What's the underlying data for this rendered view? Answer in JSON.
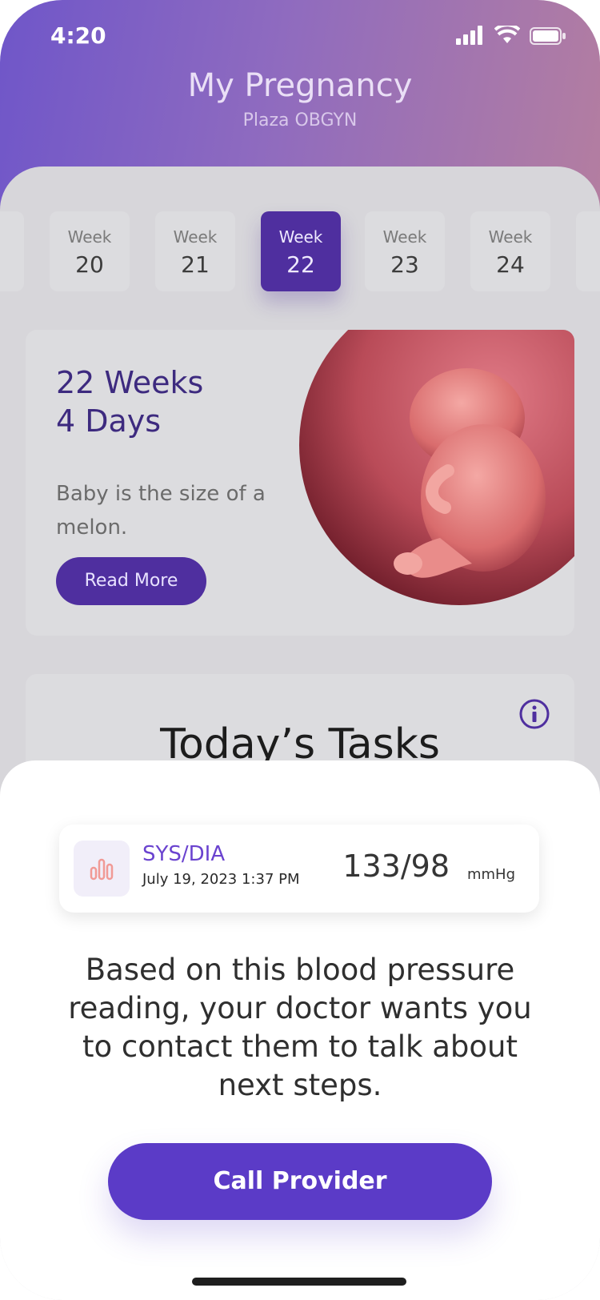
{
  "status": {
    "time": "4:20"
  },
  "header": {
    "title": "My Pregnancy",
    "subtitle": "Plaza OBGYN"
  },
  "weeks": [
    {
      "label": "Week",
      "number": "20"
    },
    {
      "label": "Week",
      "number": "21"
    },
    {
      "label": "Week",
      "number": "22"
    },
    {
      "label": "Week",
      "number": "23"
    },
    {
      "label": "Week",
      "number": "24"
    }
  ],
  "week_card": {
    "title_line1": "22 Weeks",
    "title_line2": "4 Days",
    "description": "Baby is the size of a melon.",
    "read_more": "Read More"
  },
  "tasks": {
    "title": "Today’s Tasks"
  },
  "reading": {
    "label": "SYS/DIA",
    "date": "July 19, 2023 1:37 PM",
    "value": "133/98",
    "unit": "mmHg"
  },
  "sheet": {
    "message": "Based on this blood pressure reading, your doctor wants you to contact them to talk about next steps.",
    "button": "Call Provider"
  },
  "colors": {
    "accent": "#5b3bc7",
    "week_active": "#4f2f9f",
    "title": "#3d2a7f"
  }
}
